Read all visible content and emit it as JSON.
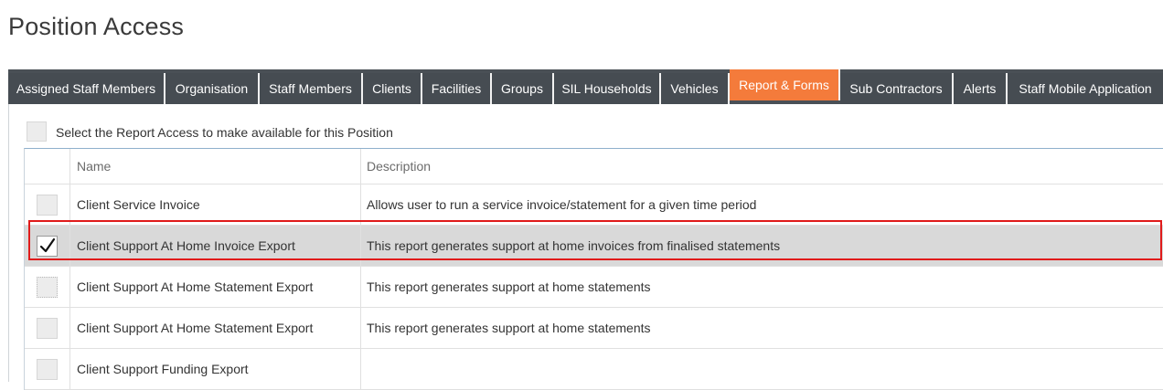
{
  "page": {
    "title": "Position Access"
  },
  "tabs": [
    {
      "label": "Assigned Staff Members",
      "active": false
    },
    {
      "label": "Organisation",
      "active": false
    },
    {
      "label": "Staff Members",
      "active": false
    },
    {
      "label": "Clients",
      "active": false
    },
    {
      "label": "Facilities",
      "active": false
    },
    {
      "label": "Groups",
      "active": false
    },
    {
      "label": "SIL Households",
      "active": false
    },
    {
      "label": "Vehicles",
      "active": false
    },
    {
      "label": "Report & Forms",
      "active": true
    },
    {
      "label": "Sub Contractors",
      "active": false
    },
    {
      "label": "Alerts",
      "active": false
    },
    {
      "label": "Staff Mobile Application",
      "active": false
    }
  ],
  "select_all": {
    "label": "Select the Report Access to make available for this Position",
    "checked": false
  },
  "grid": {
    "columns": {
      "name": "Name",
      "description": "Description"
    },
    "rows": [
      {
        "name": "Client Service Invoice",
        "description": "Allows user to run a service invoice/statement for a given time period",
        "checked": false
      },
      {
        "name": "Client Support At Home Invoice Export",
        "description": "This report generates support at home invoices from finalised statements",
        "checked": true
      },
      {
        "name": "Client Support At Home Statement Export",
        "description": "This report generates support at home statements",
        "checked": false
      },
      {
        "name": "Client Support At Home Statement Export",
        "description": "This report generates support at home statements",
        "checked": false
      },
      {
        "name": "Client Support Funding Export",
        "description": "",
        "checked": false
      }
    ]
  },
  "colors": {
    "tab_bg": "#464c52",
    "tab_active": "#f47b3b",
    "highlight": "#e01b1b",
    "selected_row": "#d9d9d9"
  },
  "icons": {
    "check": "check-icon"
  }
}
